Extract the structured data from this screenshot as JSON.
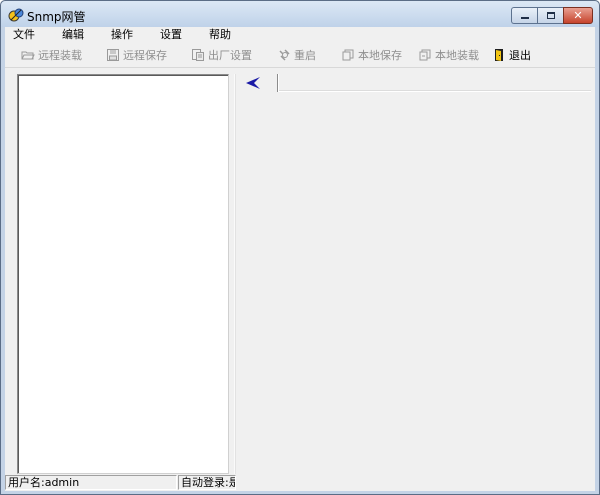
{
  "window": {
    "title": "Snmp网管",
    "app_icon": "snmp-app-icon",
    "controls": {
      "minimize": "minimize-icon",
      "maximize": "maximize-icon",
      "close": "close-icon"
    }
  },
  "menubar": {
    "items": [
      {
        "label": "文件"
      },
      {
        "label": "编辑"
      },
      {
        "label": "操作"
      },
      {
        "label": "设置"
      },
      {
        "label": "帮助"
      }
    ]
  },
  "toolbar": {
    "items": [
      {
        "label": "远程装载",
        "icon": "folder-open-icon",
        "enabled": false
      },
      {
        "label": "远程保存",
        "icon": "save-disk-icon",
        "enabled": false
      },
      {
        "label": "出厂设置",
        "icon": "factory-reset-icon",
        "enabled": false
      },
      {
        "label": "重启",
        "icon": "restart-icon",
        "enabled": false
      },
      {
        "label": "本地保存",
        "icon": "local-save-icon",
        "enabled": false
      },
      {
        "label": "本地装载",
        "icon": "local-load-icon",
        "enabled": false
      },
      {
        "label": "退出",
        "icon": "exit-door-icon",
        "enabled": true
      }
    ]
  },
  "tabs": {
    "nav_icon": "back-arrow-icon",
    "accent_color": "#1a1aa6"
  },
  "statusbar": {
    "username": "用户名:admin",
    "auto_login": "自动登录:是"
  },
  "colors": {
    "client_bg": "#f0f0f0",
    "close_button": "#c6432c"
  }
}
